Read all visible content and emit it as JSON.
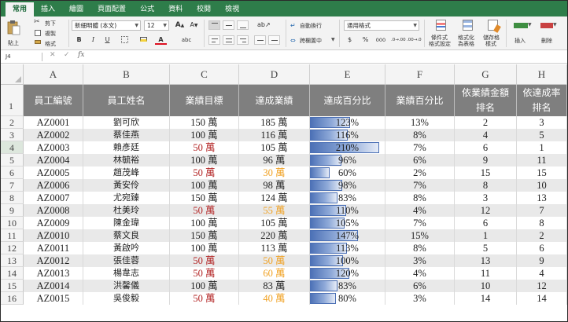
{
  "ribbon": {
    "tabs": [
      "常用",
      "插入",
      "繪圖",
      "頁面配置",
      "公式",
      "資料",
      "校閱",
      "檢視"
    ],
    "paste_label": "貼上",
    "cut_label": "剪下",
    "copy_label": "複製",
    "format_painter_label": "格式",
    "font_name": "新細明體 (本文)",
    "font_size": "12",
    "bold": "B",
    "italic": "I",
    "underline": "U",
    "grow_font": "A",
    "shrink_font": "A",
    "wrap_text_label": "自動換行",
    "merge_center_label": "跨欄置中",
    "number_format": "通用格式",
    "currency": "$",
    "percent": "%",
    "comma": "000",
    "inc_decimal": ".0→.00",
    "dec_decimal": ".00→.0",
    "conditional_format_label": [
      "條件式",
      "格式設定"
    ],
    "format_as_table_label": [
      "格式化",
      "為表格"
    ],
    "cell_styles_label": [
      "儲存格",
      "樣式"
    ],
    "insert_label": "插入",
    "delete_label": "刪除"
  },
  "formula_bar": {
    "name_box": "J4",
    "cancel_icon": "✕",
    "enter_icon": "✓",
    "fx": "fx",
    "content": ""
  },
  "sheet": {
    "columns": [
      "A",
      "B",
      "C",
      "D",
      "E",
      "F",
      "G",
      "H"
    ],
    "header_row_number": "1",
    "selected_row": 4,
    "headers": [
      "員工編號",
      "員工姓名",
      "業績目標",
      "達成業績",
      "達成百分比",
      "業績百分比",
      "依業績金額\n排名",
      "依達成率\n排名"
    ],
    "rows": [
      {
        "num": "2",
        "id": "AZ0001",
        "name": "劉可欣",
        "target": "150 萬",
        "target_color": "normal",
        "actual": "185 萬",
        "actual_color": "normal",
        "pct": "123%",
        "pct_value": 1.23,
        "share": "13%",
        "rank_amt": "2",
        "rank_rate": "3"
      },
      {
        "num": "3",
        "id": "AZ0002",
        "name": "蔡佳燕",
        "target": "100 萬",
        "target_color": "normal",
        "actual": "116 萬",
        "actual_color": "normal",
        "pct": "116%",
        "pct_value": 1.16,
        "share": "8%",
        "rank_amt": "4",
        "rank_rate": "5"
      },
      {
        "num": "4",
        "id": "AZ0003",
        "name": "賴彥廷",
        "target": "50 萬",
        "target_color": "red",
        "actual": "105 萬",
        "actual_color": "normal",
        "pct": "210%",
        "pct_value": 2.1,
        "share": "7%",
        "rank_amt": "6",
        "rank_rate": "1"
      },
      {
        "num": "5",
        "id": "AZ0004",
        "name": "林毓裕",
        "target": "100 萬",
        "target_color": "normal",
        "actual": "96 萬",
        "actual_color": "normal",
        "pct": "96%",
        "pct_value": 0.96,
        "share": "6%",
        "rank_amt": "9",
        "rank_rate": "11"
      },
      {
        "num": "6",
        "id": "AZ0005",
        "name": "趙茂峰",
        "target": "50 萬",
        "target_color": "red",
        "actual": "30 萬",
        "actual_color": "orange",
        "pct": "60%",
        "pct_value": 0.6,
        "share": "2%",
        "rank_amt": "15",
        "rank_rate": "15"
      },
      {
        "num": "7",
        "id": "AZ0006",
        "name": "黃安伶",
        "target": "100 萬",
        "target_color": "normal",
        "actual": "98 萬",
        "actual_color": "normal",
        "pct": "98%",
        "pct_value": 0.98,
        "share": "7%",
        "rank_amt": "8",
        "rank_rate": "10"
      },
      {
        "num": "8",
        "id": "AZ0007",
        "name": "尤宛臻",
        "target": "150 萬",
        "target_color": "normal",
        "actual": "124 萬",
        "actual_color": "normal",
        "pct": "83%",
        "pct_value": 0.83,
        "share": "8%",
        "rank_amt": "3",
        "rank_rate": "13"
      },
      {
        "num": "9",
        "id": "AZ0008",
        "name": "杜美玲",
        "target": "50 萬",
        "target_color": "red",
        "actual": "55 萬",
        "actual_color": "orange",
        "pct": "110%",
        "pct_value": 1.1,
        "share": "4%",
        "rank_amt": "12",
        "rank_rate": "7"
      },
      {
        "num": "10",
        "id": "AZ0009",
        "name": "陳金瑋",
        "target": "100 萬",
        "target_color": "normal",
        "actual": "105 萬",
        "actual_color": "normal",
        "pct": "105%",
        "pct_value": 1.05,
        "share": "7%",
        "rank_amt": "6",
        "rank_rate": "8"
      },
      {
        "num": "11",
        "id": "AZ0010",
        "name": "蔡文良",
        "target": "150 萬",
        "target_color": "normal",
        "actual": "220 萬",
        "actual_color": "normal",
        "pct": "147%",
        "pct_value": 1.47,
        "share": "15%",
        "rank_amt": "1",
        "rank_rate": "2"
      },
      {
        "num": "12",
        "id": "AZ0011",
        "name": "黃啟吟",
        "target": "100 萬",
        "target_color": "normal",
        "actual": "113 萬",
        "actual_color": "normal",
        "pct": "113%",
        "pct_value": 1.13,
        "share": "8%",
        "rank_amt": "5",
        "rank_rate": "6"
      },
      {
        "num": "13",
        "id": "AZ0012",
        "name": "張佳蓉",
        "target": "50 萬",
        "target_color": "red",
        "actual": "50 萬",
        "actual_color": "orange",
        "pct": "100%",
        "pct_value": 1.0,
        "share": "3%",
        "rank_amt": "13",
        "rank_rate": "9"
      },
      {
        "num": "14",
        "id": "AZ0013",
        "name": "楊韋志",
        "target": "50 萬",
        "target_color": "red",
        "actual": "60 萬",
        "actual_color": "orange",
        "pct": "120%",
        "pct_value": 1.2,
        "share": "4%",
        "rank_amt": "11",
        "rank_rate": "4"
      },
      {
        "num": "15",
        "id": "AZ0014",
        "name": "洪馨儀",
        "target": "100 萬",
        "target_color": "normal",
        "actual": "83 萬",
        "actual_color": "normal",
        "pct": "83%",
        "pct_value": 0.83,
        "share": "6%",
        "rank_amt": "10",
        "rank_rate": "12"
      },
      {
        "num": "16",
        "id": "AZ0015",
        "name": "吳俊毅",
        "target": "50 萬",
        "target_color": "red",
        "actual": "40 萬",
        "actual_color": "orange",
        "pct": "80%",
        "pct_value": 0.8,
        "share": "3%",
        "rank_amt": "14",
        "rank_rate": "14"
      }
    ]
  }
}
